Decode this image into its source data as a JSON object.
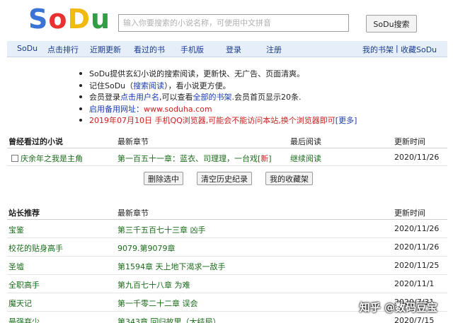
{
  "logo": {
    "c1": "S",
    "c2": "o",
    "c3": "D",
    "c4": "u"
  },
  "search": {
    "placeholder": "输入你要搜索的小说名称，可使用中文拼音",
    "button": "SoDu搜索"
  },
  "nav": {
    "items": [
      "SoDu",
      "点击排行",
      "近期更新",
      "看过的书",
      "手机版",
      "登录",
      "注册"
    ],
    "right": {
      "bookshelf": "我的书架",
      "sep": "|",
      "favorite": "收藏SoDu"
    }
  },
  "notices": {
    "n1": "SoDu提供玄幻小说的搜索阅读，更新快、无广告、页面清爽。",
    "n2_a": "记住SoDu（",
    "n2_link": "搜索阅读",
    "n2_b": "），看小说更方便。",
    "n3_a": "会员登录",
    "n3_link1": "点击用户名",
    "n3_b": ",可以查看",
    "n3_link2": "全部的书架",
    "n3_c": ".会员首页显示20条.",
    "n4_a": "启用备用网址：",
    "n4_link": "www.soduha.com",
    "n5": "2019年07月10日 手机QQ浏览器,可能会不能访问本站,换个浏览器即可",
    "n5_more": "[更多]"
  },
  "history": {
    "headers": [
      "曾经看过的小说",
      "最新章节",
      "最后阅读",
      "更新时间"
    ],
    "rows": [
      {
        "title": "庆余年之我是主角",
        "chapter": "第一百五十一章：蓝衣、司理理，一台戏[",
        "chapter_new": "新",
        "chapter_end": "]",
        "last": "继续阅读",
        "time": "2020/11/26"
      }
    ]
  },
  "actions": {
    "delete": "删除选中",
    "clear": "清空历史纪录",
    "favorites": "我的收藏架"
  },
  "recommend": {
    "headers": [
      "站长推荐",
      "最新章节",
      "更新时间"
    ],
    "rows": [
      {
        "title": "宝鉴",
        "chapter": "第三千五百七十三章 凶手",
        "time": "2020/11/26"
      },
      {
        "title": "校花的贴身高手",
        "chapter": "9079.第9079章",
        "time": "2020/11/26"
      },
      {
        "title": "圣墟",
        "chapter": "第1594章 天上地下渴求一敌手",
        "time": "2020/11/25"
      },
      {
        "title": "全职高手",
        "chapter": "第九百七十八章 为难",
        "time": "2020/11/1"
      },
      {
        "title": "魔天记",
        "chapter": "第一千零二十二章 误会",
        "time": "2020/7/31"
      },
      {
        "title": "最强弃少",
        "chapter": "第343章 回归故里（大结局）",
        "time": "2020/7/15"
      }
    ]
  },
  "watermark": "知乎 @数码豆宝"
}
